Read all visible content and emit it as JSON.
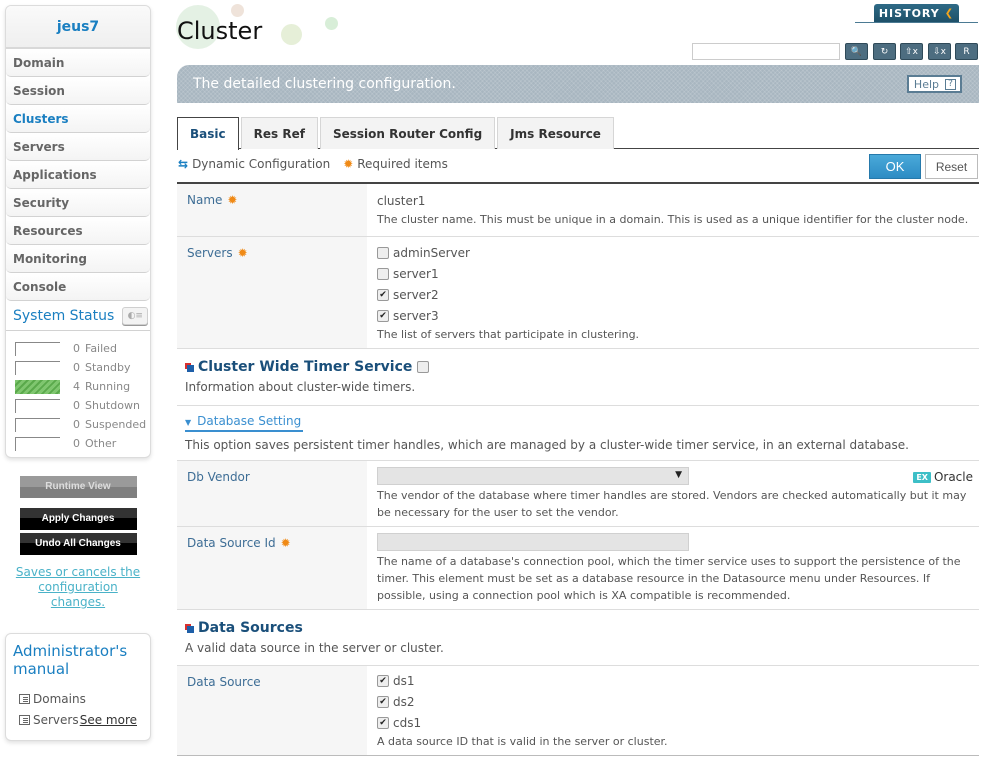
{
  "sidebar": {
    "domain": "jeus7",
    "nav": [
      {
        "label": "Domain",
        "active": false
      },
      {
        "label": "Session",
        "active": false
      },
      {
        "label": "Clusters",
        "active": true
      },
      {
        "label": "Servers",
        "active": false
      },
      {
        "label": "Applications",
        "active": false
      },
      {
        "label": "Security",
        "active": false
      },
      {
        "label": "Resources",
        "active": false
      },
      {
        "label": "Monitoring",
        "active": false
      },
      {
        "label": "Console",
        "active": false
      }
    ],
    "system_status": {
      "title": "System Status",
      "rows": [
        {
          "count": "0",
          "label": "Failed",
          "fill": 0
        },
        {
          "count": "0",
          "label": "Standby",
          "fill": 0
        },
        {
          "count": "4",
          "label": "Running",
          "fill": 1
        },
        {
          "count": "0",
          "label": "Shutdown",
          "fill": 0
        },
        {
          "count": "0",
          "label": "Suspended",
          "fill": 0
        },
        {
          "count": "0",
          "label": "Other",
          "fill": 0
        }
      ]
    },
    "runtime_view": "Runtime View",
    "apply_changes": "Apply Changes",
    "undo_changes": "Undo All Changes",
    "save_note": "Saves or cancels the configuration changes.",
    "manual": {
      "title": "Administrator's manual",
      "links": [
        "Domains",
        "Servers"
      ],
      "see_more": "See more"
    }
  },
  "header": {
    "title": "Cluster",
    "history": "HISTORY",
    "search_placeholder": "",
    "tools": [
      "search-icon",
      "refresh-icon",
      "xml-export-icon",
      "xml-import-icon",
      "report-icon"
    ],
    "banner": "The detailed clustering configuration.",
    "help": "Help",
    "help_icon": "?"
  },
  "tabs": [
    {
      "label": "Basic",
      "active": true
    },
    {
      "label": "Res Ref",
      "active": false
    },
    {
      "label": "Session Router Config",
      "active": false
    },
    {
      "label": "Jms Resource",
      "active": false
    }
  ],
  "legend": {
    "dynamic": "Dynamic Configuration",
    "required": "Required items"
  },
  "buttons": {
    "ok": "OK",
    "reset": "Reset"
  },
  "form": {
    "name": {
      "label": "Name",
      "value": "cluster1",
      "hint": "The cluster name. This must be unique in a domain. This is used as a unique identifier for the cluster node."
    },
    "servers": {
      "label": "Servers",
      "options": [
        {
          "label": "adminServer",
          "checked": false
        },
        {
          "label": "server1",
          "checked": false
        },
        {
          "label": "server2",
          "checked": true
        },
        {
          "label": "server3",
          "checked": true
        }
      ],
      "hint": "The list of servers that participate in clustering."
    },
    "timer_service": {
      "title": "Cluster Wide Timer Service",
      "checked": false,
      "desc": "Information about cluster-wide timers."
    },
    "database_setting": {
      "title": "Database Setting",
      "desc": "This option saves persistent timer handles, which are managed by a cluster-wide timer service, in an external database."
    },
    "db_vendor": {
      "label": "Db Vendor",
      "value": "",
      "example_tag": "EX",
      "example": "Oracle",
      "hint": "The vendor of the database where timer handles are stored. Vendors are checked automatically but it may be necessary for the user to set the vendor."
    },
    "data_source_id": {
      "label": "Data Source Id",
      "value": "",
      "hint": "The name of a database's connection pool, which the timer service uses to support the persistence of the timer. This element must be set as a database resource in the Datasource menu under Resources. If possible, using a connection pool which is XA compatible is recommended."
    },
    "data_sources": {
      "title": "Data Sources",
      "desc": "A valid data source in the server or cluster."
    },
    "data_source": {
      "label": "Data Source",
      "options": [
        {
          "label": "ds1",
          "checked": true
        },
        {
          "label": "ds2",
          "checked": true
        },
        {
          "label": "cds1",
          "checked": true
        }
      ],
      "hint": "A data source ID that is valid in the server or cluster."
    }
  }
}
